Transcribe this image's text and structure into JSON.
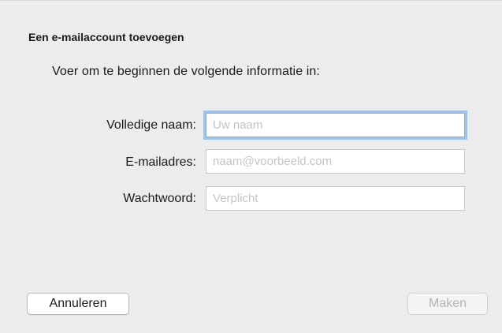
{
  "dialog": {
    "title": "Een e-mailaccount toevoegen",
    "subtitle": "Voer om te beginnen de volgende informatie in:"
  },
  "form": {
    "name_label": "Volledige naam:",
    "name_placeholder": "Uw naam",
    "name_value": "",
    "email_label": "E-mailadres:",
    "email_placeholder": "naam@voorbeeld.com",
    "email_value": "",
    "password_label": "Wachtwoord:",
    "password_placeholder": "Verplicht",
    "password_value": ""
  },
  "buttons": {
    "cancel_label": "Annuleren",
    "create_label": "Maken",
    "create_enabled": false
  },
  "colors": {
    "background": "#ececec",
    "focus_ring": "#9cc2f0",
    "placeholder": "#c4c4c4",
    "disabled_text": "#b3b3b3"
  }
}
